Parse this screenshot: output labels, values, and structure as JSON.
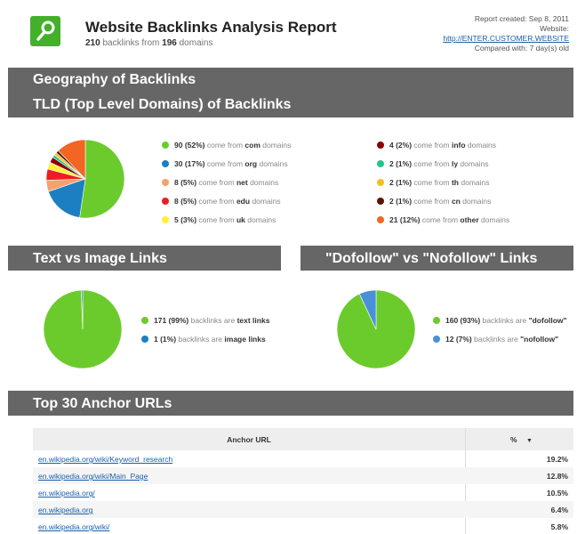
{
  "header": {
    "title": "Website Backlinks Analysis Report",
    "subtitle": {
      "backlinks": "210",
      "backlinks_text": "backlinks from",
      "domains": "196",
      "domains_text": "domains"
    },
    "meta": {
      "created": "Report created: Sep 8, 2011",
      "website_label": "Website:",
      "website_url": "http://ENTER.CUSTOMER.WEBSITE",
      "compared": "Compared with: 7 day(s) old"
    }
  },
  "sections": {
    "geography": "Geography of Backlinks",
    "tld": "TLD (Top Level Domains) of Backlinks",
    "text_image": "Text vs Image Links",
    "follow": "\"Dofollow\" vs \"Nofollow\" Links",
    "anchors": "Top 30 Anchor URLs"
  },
  "tld_legend": [
    {
      "count": "90 (52%)",
      "text": "come from",
      "name": "com",
      "suffix": "domains",
      "color": "#6ccb2c"
    },
    {
      "count": "30 (17%)",
      "text": "come from",
      "name": "org",
      "suffix": "domains",
      "color": "#1c7fc1"
    },
    {
      "count": "8 (5%)",
      "text": "come from",
      "name": "net",
      "suffix": "domains",
      "color": "#f4a171"
    },
    {
      "count": "8 (5%)",
      "text": "come from",
      "name": "edu",
      "suffix": "domains",
      "color": "#ee1c24"
    },
    {
      "count": "5 (3%)",
      "text": "come from",
      "name": "uk",
      "suffix": "domains",
      "color": "#fff13a"
    },
    {
      "count": "4 (2%)",
      "text": "come from",
      "name": "info",
      "suffix": "domains",
      "color": "#8b0000"
    },
    {
      "count": "2 (1%)",
      "text": "come from",
      "name": "ly",
      "suffix": "domains",
      "color": "#23c38f"
    },
    {
      "count": "2 (1%)",
      "text": "come from",
      "name": "th",
      "suffix": "domains",
      "color": "#f2c01e"
    },
    {
      "count": "2 (1%)",
      "text": "come from",
      "name": "cn",
      "suffix": "domains",
      "color": "#5a1505"
    },
    {
      "count": "21 (12%)",
      "text": "come from",
      "name": "other",
      "suffix": "domains",
      "color": "#f26522"
    }
  ],
  "text_image_legend": [
    {
      "count": "171 (99%)",
      "text": "backlinks are",
      "name": "text links",
      "color": "#6ccb2c"
    },
    {
      "count": "1 (1%)",
      "text": "backlinks are",
      "name": "image links",
      "color": "#1c7fc1"
    }
  ],
  "follow_legend": [
    {
      "count": "160 (93%)",
      "text": "backlinks are",
      "name": "\"dofollow\"",
      "color": "#6ccb2c"
    },
    {
      "count": "12 (7%)",
      "text": "backlinks are",
      "name": "\"nofollow\"",
      "color": "#4a90d9"
    }
  ],
  "chart_data": [
    {
      "type": "pie",
      "categories": [
        "com",
        "org",
        "net",
        "edu",
        "uk",
        "info",
        "ly",
        "th",
        "cn",
        "other"
      ],
      "values": [
        90,
        30,
        8,
        8,
        5,
        4,
        2,
        2,
        2,
        21
      ],
      "colors": [
        "#6ccb2c",
        "#1c7fc1",
        "#f4a171",
        "#ee1c24",
        "#fff13a",
        "#8b0000",
        "#23c38f",
        "#f2c01e",
        "#5a1505",
        "#f26522"
      ]
    },
    {
      "type": "pie",
      "categories": [
        "text links",
        "image links"
      ],
      "values": [
        171,
        1
      ],
      "colors": [
        "#6ccb2c",
        "#1c7fc1"
      ]
    },
    {
      "type": "pie",
      "categories": [
        "dofollow",
        "nofollow"
      ],
      "values": [
        160,
        12
      ],
      "colors": [
        "#6ccb2c",
        "#4a90d9"
      ]
    }
  ],
  "anchors_table": {
    "headers": [
      "Anchor URL",
      "%"
    ],
    "rows": [
      {
        "url": "en.wikipedia.org/wiki/Keyword_research",
        "pct": "19.2%"
      },
      {
        "url": "en.wikipedia.org/wiki/Main_Page",
        "pct": "12.8%"
      },
      {
        "url": "en.wikipedia.org/",
        "pct": "10.5%"
      },
      {
        "url": "en.wikipedia.org",
        "pct": "6.4%"
      },
      {
        "url": "en.wikipedia.org/wiki/",
        "pct": "5.8%"
      }
    ]
  }
}
